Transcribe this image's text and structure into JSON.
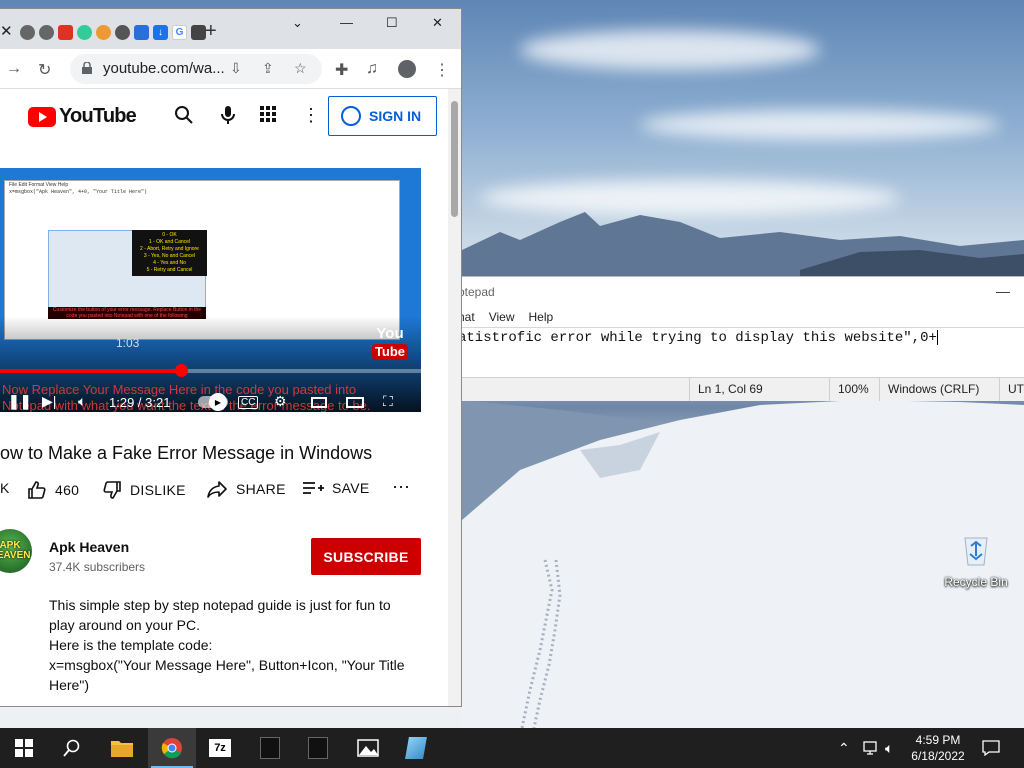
{
  "chrome": {
    "omnibox_url": "youtube.com/wa..."
  },
  "youtube": {
    "brand": "YouTube",
    "sign_in_label": "SIGN IN",
    "video": {
      "elapsed_popup": "1:03",
      "time_display": "1:29 / 3:21",
      "progress": 0.43,
      "caption_line1": "Now Replace Your Message Here in the code you pasted into",
      "caption_line2": "Notepad with what you want the text of the error message to be.",
      "watermark_top": "You",
      "watermark_bottom": "Tube",
      "inner_notepad_menu": "File  Edit  Format  View  Help",
      "inner_code": "x=msgbox(\"Apk Heaven\", 4+0, \"Your Title Here\")",
      "inner_options": [
        "0 - OK",
        "1 - OK and Cancel",
        "2 - Abort, Retry and Ignore",
        "3 - Yes, No and Cancel",
        "4 - Yes and No",
        "5 - Retry and Cancel"
      ],
      "inner_note": "Customize the button of your error message. Replace Button in the code you pasted into Notepad with one of the following"
    },
    "title": "ow to Make a Fake Error Message in Windows",
    "views_partial": "K",
    "like_count": "460",
    "dislike_label": "DISLIKE",
    "share_label": "SHARE",
    "save_label": "SAVE",
    "channel": {
      "avatar_text_1": "APK",
      "avatar_text_2": "HEAVEN",
      "name": "Apk Heaven",
      "subscribers": "37.4K subscribers"
    },
    "subscribe_label": "SUBSCRIBE",
    "description": [
      "This simple step by step notepad guide is just for fun to",
      "play around on your PC.",
      "Here is the template code:",
      "x=msgbox(\"Your Message Here\", Button+Icon, \"Your Title",
      "Here\")"
    ]
  },
  "notepad": {
    "title": "Notepad",
    "menu": [
      "nat",
      "View",
      "Help"
    ],
    "content": "atistrofic error while trying to display this website\",0+",
    "status": {
      "position": "Ln 1, Col 69",
      "zoom": "100%",
      "line_ending": "Windows (CRLF)",
      "encoding": "UTF"
    }
  },
  "desktop": {
    "recycle_bin_label": "Recycle Bin"
  },
  "taskbar": {
    "time": "4:59 PM",
    "date": "6/18/2022"
  }
}
